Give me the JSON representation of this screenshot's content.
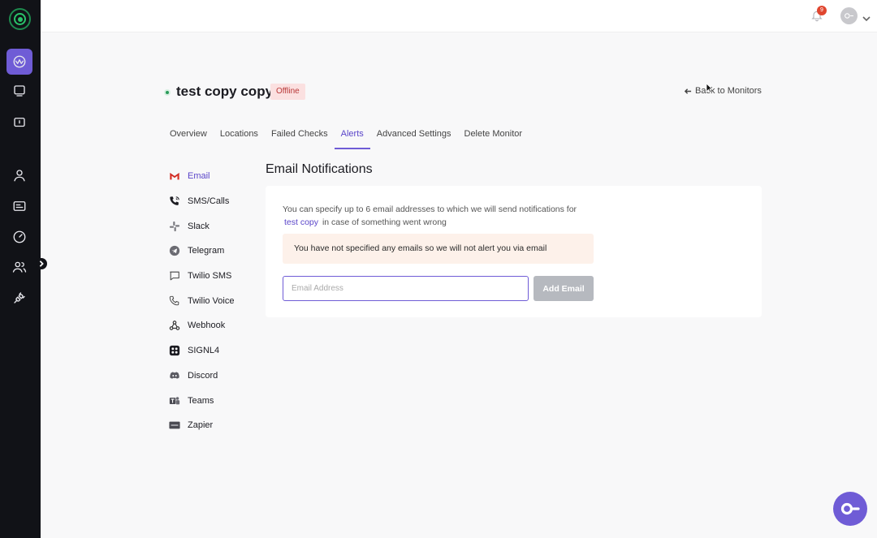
{
  "topbar": {
    "notification_count": "9"
  },
  "header": {
    "monitor_name": "test copy copy",
    "status": "Offline",
    "back_link": "Back to Monitors"
  },
  "tabs": [
    {
      "label": "Overview",
      "active": false
    },
    {
      "label": "Locations",
      "active": false
    },
    {
      "label": "Failed Checks",
      "active": false
    },
    {
      "label": "Alerts",
      "active": true
    },
    {
      "label": "Advanced Settings",
      "active": false
    },
    {
      "label": "Delete Monitor",
      "active": false
    }
  ],
  "channels": [
    {
      "label": "Email",
      "icon": "gmail-icon",
      "active": true
    },
    {
      "label": "SMS/Calls",
      "icon": "phone-call-icon"
    },
    {
      "label": "Slack",
      "icon": "slack-icon"
    },
    {
      "label": "Telegram",
      "icon": "telegram-icon"
    },
    {
      "label": "Twilio SMS",
      "icon": "message-icon"
    },
    {
      "label": "Twilio Voice",
      "icon": "phone-icon"
    },
    {
      "label": "Webhook",
      "icon": "webhook-icon"
    },
    {
      "label": "SIGNL4",
      "icon": "signl4-icon"
    },
    {
      "label": "Discord",
      "icon": "discord-icon"
    },
    {
      "label": "Teams",
      "icon": "teams-icon"
    },
    {
      "label": "Zapier",
      "icon": "zapier-icon"
    }
  ],
  "panel": {
    "title": "Email Notifications",
    "desc_before": "You can specify up to 6 email addresses to which we will send notifications for",
    "desc_monitor": "test copy",
    "desc_after": "in case of something went wrong",
    "warning": "You have not specified any emails so we will not alert you via email",
    "input_placeholder": "Email Address",
    "add_button": "Add Email"
  },
  "colors": {
    "accent": "#6f5cd6",
    "sidebar": "#111217",
    "offline_badge_bg": "#fbe0e0",
    "warning_bg": "#fdf1ea"
  }
}
